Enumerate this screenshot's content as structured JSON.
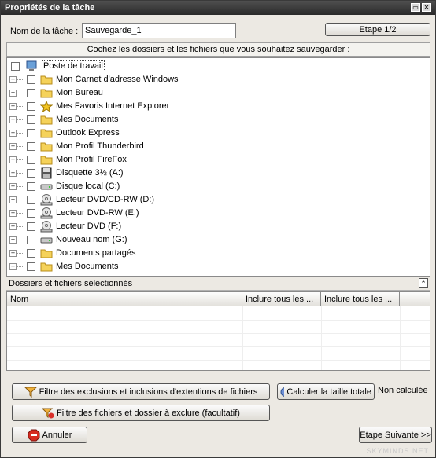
{
  "window": {
    "title": "Propriétés de la tâche",
    "restore_glyph": "▭",
    "close_glyph": "✕"
  },
  "form": {
    "task_name_label": "Nom de la tâche :",
    "task_name_value": "Sauvegarde_1",
    "step_label": "Etape 1/2"
  },
  "tree": {
    "instruction": "Cochez les dossiers et les fichiers que vous souhaitez sauvegarder :",
    "root": {
      "label": "Poste de travail",
      "icon": "computer-icon"
    },
    "items": [
      {
        "label": "Mon Carnet d'adresse Windows",
        "icon": "folder-icon"
      },
      {
        "label": "Mon Bureau",
        "icon": "folder-icon"
      },
      {
        "label": "Mes Favoris Internet Explorer",
        "icon": "star-icon"
      },
      {
        "label": "Mes Documents",
        "icon": "folder-icon"
      },
      {
        "label": "Outlook Express",
        "icon": "folder-icon"
      },
      {
        "label": "Mon Profil Thunderbird",
        "icon": "folder-icon"
      },
      {
        "label": "Mon Profil FireFox",
        "icon": "folder-icon"
      },
      {
        "label": "Disquette 3½ (A:)",
        "icon": "floppy-icon"
      },
      {
        "label": "Disque local (C:)",
        "icon": "harddisk-icon"
      },
      {
        "label": "Lecteur DVD/CD-RW (D:)",
        "icon": "cd-drive-icon"
      },
      {
        "label": "Lecteur DVD-RW (E:)",
        "icon": "cd-drive-icon"
      },
      {
        "label": "Lecteur DVD (F:)",
        "icon": "cd-drive-icon"
      },
      {
        "label": "Nouveau nom (G:)",
        "icon": "harddisk-icon"
      },
      {
        "label": "Documents partagés",
        "icon": "folder-icon"
      },
      {
        "label": "Mes Documents",
        "icon": "folder-icon"
      }
    ]
  },
  "selection": {
    "title": "Dossiers et fichiers sélectionnés",
    "collapse_glyph": "⌃",
    "columns": [
      "Nom",
      "Inclure tous les ...",
      "Inclure tous les ..."
    ]
  },
  "actions": {
    "filter_extensions": "Filtre des exclusions et inclusions d'extentions de fichiers",
    "compute_size": "Calculer la taille totale",
    "size_status": "Non calculée",
    "filter_exclude": "Filtre des fichiers et dossier à exclure (facultatif)",
    "cancel": "Annuler",
    "next": "Etape Suivante >>"
  },
  "watermark": "SKYMINDS.NET"
}
